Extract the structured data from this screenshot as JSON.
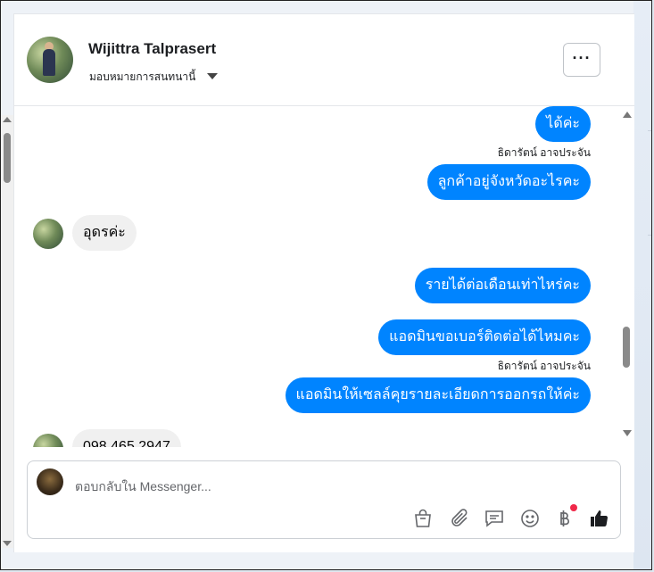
{
  "contact": {
    "name": "Wijittra Talprasert",
    "assign_label": "มอบหมายการสนทนานี้",
    "more_label": "···"
  },
  "messages": [
    {
      "direction": "out",
      "text": "ได้ค่ะ"
    },
    {
      "direction": "sender_label",
      "text": "ธิดารัตน์ อาจประจัน"
    },
    {
      "direction": "out",
      "text": "ลูกค้าอยู่จังหวัดอะไรคะ"
    },
    {
      "direction": "in",
      "text": "อุดรค่ะ"
    },
    {
      "direction": "out",
      "text": "รายได้ต่อเดือนเท่าไหร่คะ"
    },
    {
      "direction": "out",
      "text": "แอดมินขอเบอร์ติดต่อได้ไหมคะ"
    },
    {
      "direction": "sender_label",
      "text": "ธิดารัตน์ อาจประจัน"
    },
    {
      "direction": "out",
      "text": "แอดมินให้เซลล์คุยรายละเอียดการออกรถให้ค่ะ"
    },
    {
      "direction": "in",
      "text": "098 465 2947"
    }
  ],
  "composer": {
    "placeholder": "ตอบกลับใน Messenger...",
    "tools": [
      "shopping-bag-icon",
      "paperclip-icon",
      "saved-reply-icon",
      "emoji-icon",
      "baht-payment-icon",
      "like-icon"
    ]
  },
  "colors": {
    "outgoing_bubble": "#0084ff",
    "incoming_bubble": "#f0f0f0",
    "notification_dot": "#f02849"
  }
}
